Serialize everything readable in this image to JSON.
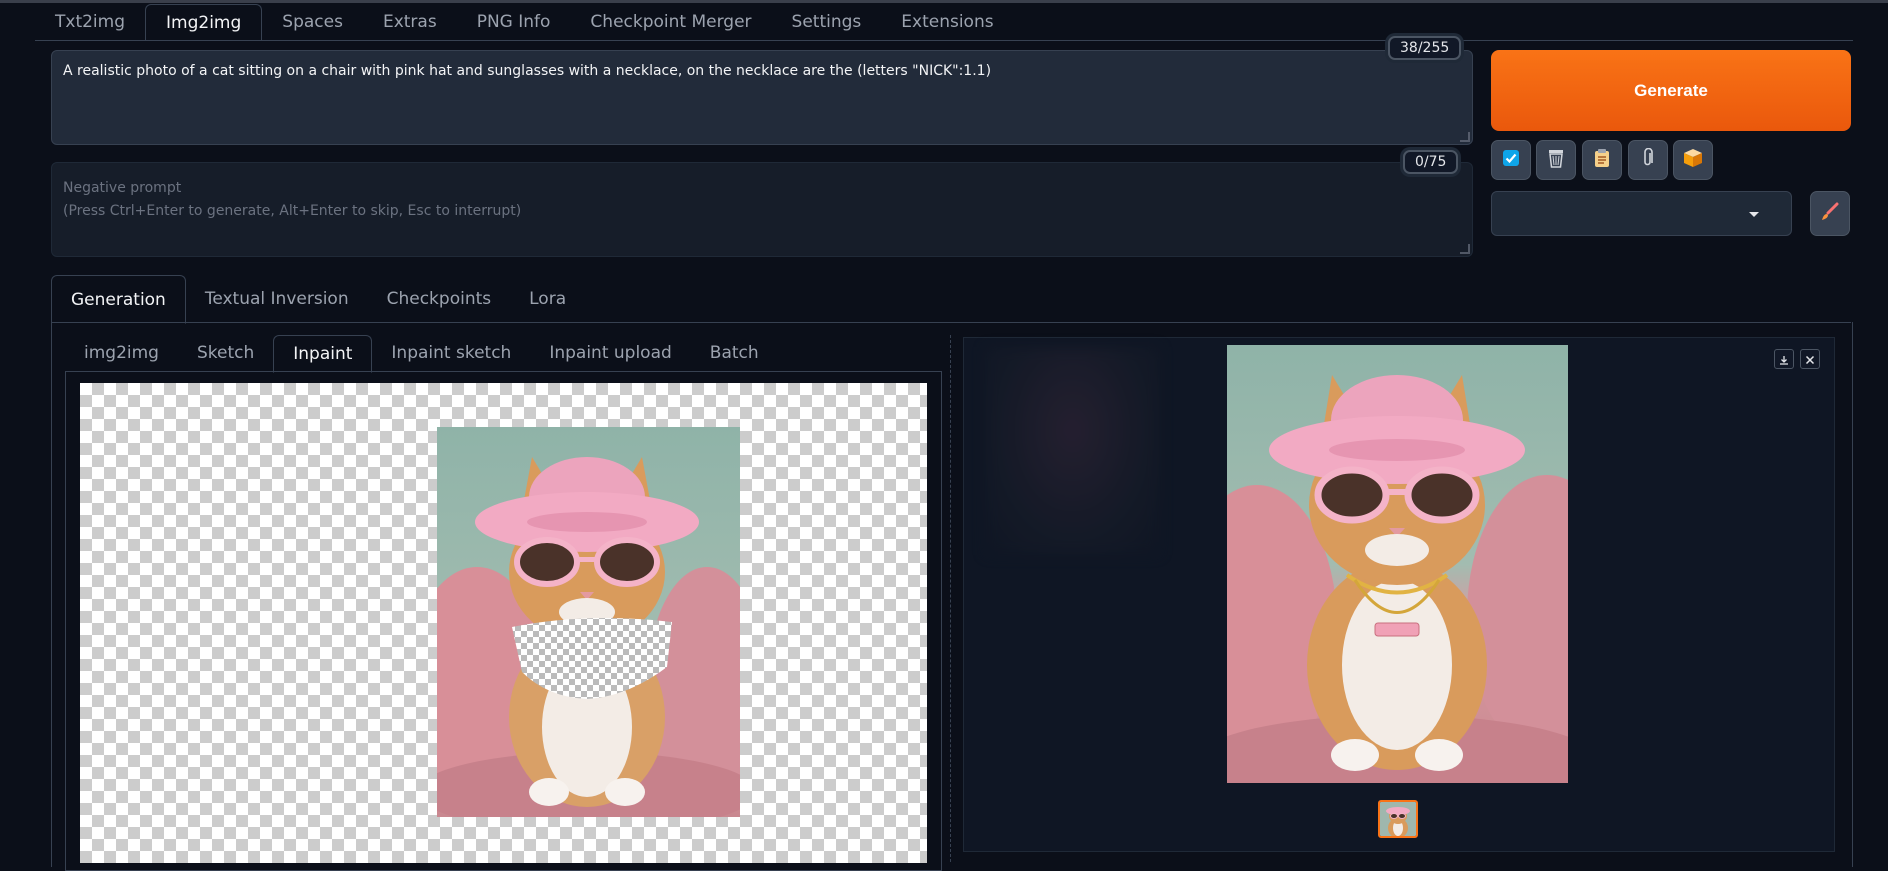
{
  "main_tabs": [
    "Txt2img",
    "Img2img",
    "Spaces",
    "Extras",
    "PNG Info",
    "Checkpoint Merger",
    "Settings",
    "Extensions"
  ],
  "active_main_tab": "Img2img",
  "prompt": {
    "text": "A realistic photo of a cat sitting on a chair with pink hat and sunglasses with a necklace, on the necklace are the (letters \"NICK\":1.1)",
    "counter": "38/255"
  },
  "negative_prompt": {
    "placeholder_line1": "Negative prompt",
    "placeholder_line2": "(Press Ctrl+Enter to generate, Alt+Enter to skip, Esc to interrupt)",
    "counter": "0/75"
  },
  "generate_label": "Generate",
  "tool_icons": [
    "checkbox-icon",
    "trash-icon",
    "clipboard-icon",
    "paperclip-icon",
    "package-icon"
  ],
  "style_select": {
    "value": ""
  },
  "sub_tabs": [
    "Generation",
    "Textual Inversion",
    "Checkpoints",
    "Lora"
  ],
  "active_sub_tab": "Generation",
  "inner_tabs": [
    "img2img",
    "Sketch",
    "Inpaint",
    "Inpaint sketch",
    "Inpaint upload",
    "Batch"
  ],
  "active_inner_tab": "Inpaint",
  "output_thumbnail_selected": true,
  "colors": {
    "accent": "#f97316",
    "background": "#0b0f19"
  }
}
